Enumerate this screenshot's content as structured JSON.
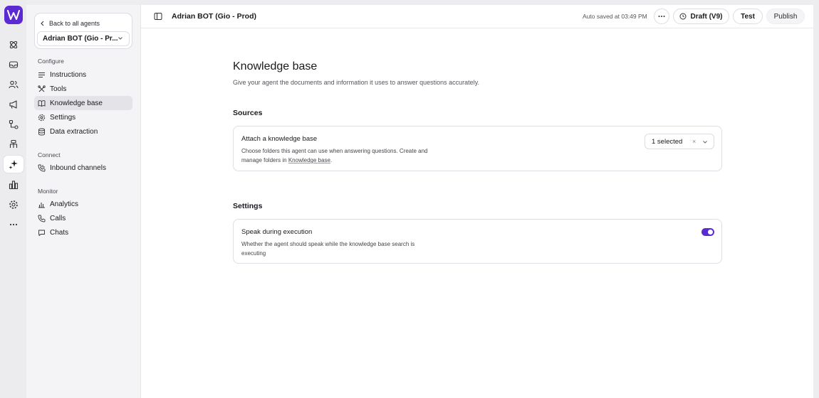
{
  "rail": {
    "logo": "W",
    "icons": [
      "atom-icon",
      "inbox-icon",
      "users-icon",
      "megaphone-icon",
      "flow-icon",
      "sitemap-icon",
      "sparkle-icon",
      "chart-icon",
      "gear-icon",
      "more-icon"
    ],
    "active": "sparkle-icon"
  },
  "sidebar": {
    "back_label": "Back to all agents",
    "agent_name": "Adrian BOT (Gio - Pr...",
    "sections": {
      "configure": "Configure",
      "connect": "Connect",
      "monitor": "Monitor"
    },
    "items": {
      "instructions": "Instructions",
      "tools": "Tools",
      "knowledge_base": "Knowledge base",
      "settings": "Settings",
      "data_extraction": "Data extraction",
      "inbound_channels": "Inbound channels",
      "analytics": "Analytics",
      "calls": "Calls",
      "chats": "Chats"
    },
    "active_item": "knowledge_base"
  },
  "topbar": {
    "title": "Adrian BOT (Gio - Prod)",
    "autosave": "Auto saved at 03:49 PM",
    "draft_label": "Draft (V9)",
    "test_label": "Test",
    "publish_label": "Publish"
  },
  "page": {
    "title": "Knowledge base",
    "subtitle": "Give your agent the documents and information it uses to answer questions accurately.",
    "sources": {
      "heading": "Sources",
      "card_title": "Attach a knowledge base",
      "card_desc_prefix": "Choose folders this agent can use when answering questions. Create and manage folders in ",
      "card_desc_link": "Knowledge base",
      "card_desc_suffix": ".",
      "select_value": "1 selected",
      "clear_symbol": "×"
    },
    "settings": {
      "heading": "Settings",
      "card_title": "Speak during execution",
      "card_desc": "Whether the agent should speak while the knowledge base search is executing",
      "toggle_on": true
    }
  },
  "colors": {
    "accent": "#5b2ad3",
    "sidebar_bg": "#f4f4f6",
    "active_bg": "#e3e3e8"
  }
}
